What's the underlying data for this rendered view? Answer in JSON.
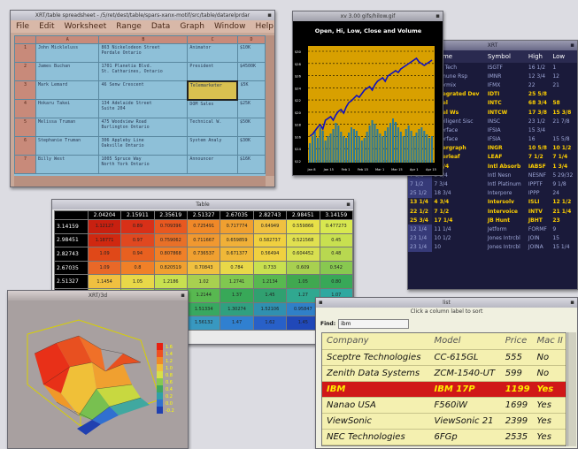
{
  "spreadsheet": {
    "title": "XRT/table spreadsheet - /5/ret/dest/table/spars-xanx-motif/src/table/datarelprdar",
    "menu": [
      "File",
      "Edit",
      "Worksheet",
      "Range",
      "Data",
      "Graph",
      "Window"
    ],
    "help": "Help",
    "cols": [
      "",
      "A",
      "B",
      "C",
      "D"
    ],
    "rows": [
      [
        "1",
        "John Mickleluss",
        "863 Nickelodeon Street\nPerdale Ontario",
        "Animator",
        "$10K"
      ],
      [
        "2",
        "James Buchan",
        "1701 Planetia Blvd.\nSt. Catharines, Ontario",
        "President",
        "$4500K"
      ],
      [
        "3",
        "Mark Lemard",
        "46 Senw Crescent",
        "Telemarketer",
        "$5K"
      ],
      [
        "4",
        "Hokaru Takei",
        "134 Adelaide Street\nSuite 204",
        "DOM Sales",
        "$25K"
      ],
      [
        "5",
        "Melissa Truman",
        "475 Woodview Road\nBurlington Ontario",
        "Technical W.",
        "$50K"
      ],
      [
        "6",
        "Stephanie Truman",
        "306 Appleby Line\nOakville Ontario",
        "System Analy",
        "$30K"
      ],
      [
        "7",
        "Billy West",
        "1005 Spruce Way\nNorth York Ontario",
        "Announcer",
        "$16K"
      ]
    ],
    "selected": "Telemarketer"
  },
  "chart": {
    "title_bar": "xv 3.00  gifs/hilow.gif",
    "title": "Open, Hi, Low, Close and Volume",
    "xticks": [
      "Jan 8",
      "Jan 15",
      "Feb 1",
      "Feb 15",
      "Mar 1",
      "Mar 15",
      "Apr 1",
      "Apr 15"
    ],
    "yticks": [
      "$30",
      "$28",
      "$26",
      "$24",
      "$22",
      "$20",
      "$18",
      "$16",
      "$14",
      "$12"
    ]
  },
  "stocks": {
    "title": "XRT",
    "headers": [
      "Ib",
      "Name",
      "Symbol",
      "High",
      "Low"
    ],
    "rows": [
      [
        "18",
        "ISG Tech",
        "ISGTF",
        "16 1/2",
        "1",
        false
      ],
      [
        "14",
        "Immune Rsp",
        "IMNR",
        "12 3/4",
        "12",
        false
      ],
      [
        "14",
        "Informix",
        "IFMX",
        "22",
        "21",
        false
      ],
      [
        "",
        "Integrated Dev",
        "IDTI",
        "25 5/8",
        "",
        true
      ],
      [
        "",
        "Intel",
        "INTC",
        "68 3/4",
        "58",
        true
      ],
      [
        "",
        "Intel Ws",
        "INTCW",
        "17 3/8",
        "15 3/8",
        true
      ],
      [
        "",
        "Intelligent Sisc",
        "INSC",
        "23 1/2",
        "21 7/8",
        false
      ],
      [
        "",
        "Interface",
        "IFSIA",
        "15 3/4",
        "",
        false
      ],
      [
        "",
        "Interface",
        "IFSIA",
        "16",
        "15 5/8",
        false
      ],
      [
        "",
        "Intergraph",
        "INGR",
        "10 5/8",
        "10 1/2",
        true
      ],
      [
        "",
        "Interleaf",
        "LEAF",
        "7 1/2",
        "7 1/4",
        true
      ],
      [
        "5 1/2",
        "1 3/4",
        "Intl Absorb",
        "IABSF",
        "1 3/4",
        true
      ],
      [
        "7 1/8",
        "3 1/4",
        "Intl Nesn",
        "NESNF",
        "5 29/32",
        false
      ],
      [
        "7 1/2",
        "7 3/4",
        "Intl Platinum",
        "IPPTF",
        "9 1/8",
        false
      ],
      [
        "25 1/2",
        "18 3/4",
        "Interpore",
        "IPPP",
        "24",
        false
      ],
      [
        "13 1/4",
        "4 3/4",
        "Intersolv",
        "ISLI",
        "12 1/2",
        true
      ],
      [
        "22 1/2",
        "7 1/2",
        "Intervoice",
        "INTV",
        "21 1/4",
        true
      ],
      [
        "25 3/4",
        "17 1/4",
        "JB Hunt",
        "JBHT",
        "23",
        true
      ],
      [
        "12 1/4",
        "11 1/4",
        "Jetform",
        "FORMF",
        "9",
        false
      ],
      [
        "23 1/4",
        "10 1/2",
        "Jones Intrcbl",
        "JOIN",
        "15",
        false
      ],
      [
        "23 1/4",
        "10",
        "Jones Intrcbl",
        "JOINA",
        "15 1/4",
        false
      ]
    ]
  },
  "heatmap": {
    "title": "Table",
    "cols": [
      "2.04204",
      "2.15911",
      "2.35619",
      "2.51327",
      "2.67035",
      "2.82743",
      "2.98451",
      "3.14159"
    ],
    "rows": [
      "3.14159",
      "2.98451",
      "2.82743",
      "2.67035",
      "2.51327",
      "2.35619",
      "2.20",
      "2.04"
    ],
    "values": [
      [
        "1.12127",
        "0.89",
        "0.709396",
        "0.725491",
        "0.717774",
        "0.64949",
        "0.559866",
        "0.477273"
      ],
      [
        "1.18771",
        "0.97",
        "0.759062",
        "0.711667",
        "0.659859",
        "0.582737",
        "0.521568",
        "0.45"
      ],
      [
        "1.09",
        "0.94",
        "0.807868",
        "0.736537",
        "0.671377",
        "0.56494",
        "0.604452",
        "0.48"
      ],
      [
        "1.09",
        "0.8",
        "0.820519",
        "0.70843",
        "0.784",
        "0.733",
        "0.609",
        "0.542"
      ],
      [
        "1.1454",
        "1.05",
        "1.2186",
        "1.02",
        "1.2741",
        "1.2134",
        "1.05",
        "0.80"
      ],
      [
        "1.12127",
        "1.16853",
        "1.27",
        "1.2144",
        "1.37",
        "1.45",
        "1.27",
        "1.07"
      ],
      [
        "1.2",
        "1.14",
        "1.16",
        "1.51334",
        "1.30274",
        "1.52106",
        "0.95847",
        "0.63"
      ],
      [
        "",
        "",
        "",
        "1.56132",
        "1.47",
        "1.62",
        "1.45",
        "1.64628"
      ]
    ],
    "colors": [
      [
        "#c82010",
        "#d83018",
        "#e85820",
        "#f08828",
        "#f0a030",
        "#f0c040",
        "#e8e048",
        "#d8e850"
      ],
      [
        "#d02810",
        "#e04820",
        "#e87028",
        "#f09830",
        "#f0b038",
        "#f0d040",
        "#e0e050",
        "#c8e050"
      ],
      [
        "#e04818",
        "#e86020",
        "#f08028",
        "#f0a030",
        "#f0b838",
        "#f0d040",
        "#d8e050",
        "#b8d850"
      ],
      [
        "#e86828",
        "#f08028",
        "#f0a030",
        "#f0c040",
        "#e8d848",
        "#c8e050",
        "#a8d050",
        "#88c850"
      ],
      [
        "#f0c040",
        "#e8d848",
        "#c8e050",
        "#a8d050",
        "#80c850",
        "#58b850",
        "#40a850",
        "#38a858"
      ],
      [
        "#d8e050",
        "#a8d050",
        "#80c050",
        "#58b850",
        "#38a858",
        "#30a070",
        "#30a890",
        "#30a8a0"
      ],
      [
        "#a8d050",
        "#70c050",
        "#48b050",
        "#38a860",
        "#30a080",
        "#3090b0",
        "#3080c8",
        "#3070d0"
      ],
      [
        "#dcdce2",
        "#dcdce2",
        "#dcdce2",
        "#3898c0",
        "#3080d0",
        "#2860c8",
        "#2048b8",
        "#1830a8"
      ]
    ]
  },
  "surface": {
    "title": "XRT/3d",
    "legend": [
      "1.6",
      "1.4",
      "1.2",
      "1.0",
      "0.8",
      "0.6",
      "0.4",
      "0.2",
      "0.0",
      "-0.2"
    ]
  },
  "sorttable": {
    "title": "list",
    "hint": "Click a column label to sort",
    "find_label": "Find:",
    "find_value": "ibm",
    "headers": [
      "Company",
      "Model",
      "Price",
      "Mac II"
    ],
    "rows": [
      [
        "Sceptre Technologies",
        "CC-615GL",
        "555",
        "No"
      ],
      [
        "Zenith Data Systems",
        "ZCM-1540-UT",
        "599",
        "No"
      ],
      [
        "IBM",
        "IBM 17P",
        "1199",
        "Yes"
      ],
      [
        "Nanao USA",
        "F560iW",
        "1699",
        "Yes"
      ],
      [
        "ViewSonic",
        "ViewSonic 21",
        "2399",
        "Yes"
      ],
      [
        "NEC Technologies",
        "6FGp",
        "2535",
        "Yes"
      ]
    ],
    "selected_index": 2
  }
}
